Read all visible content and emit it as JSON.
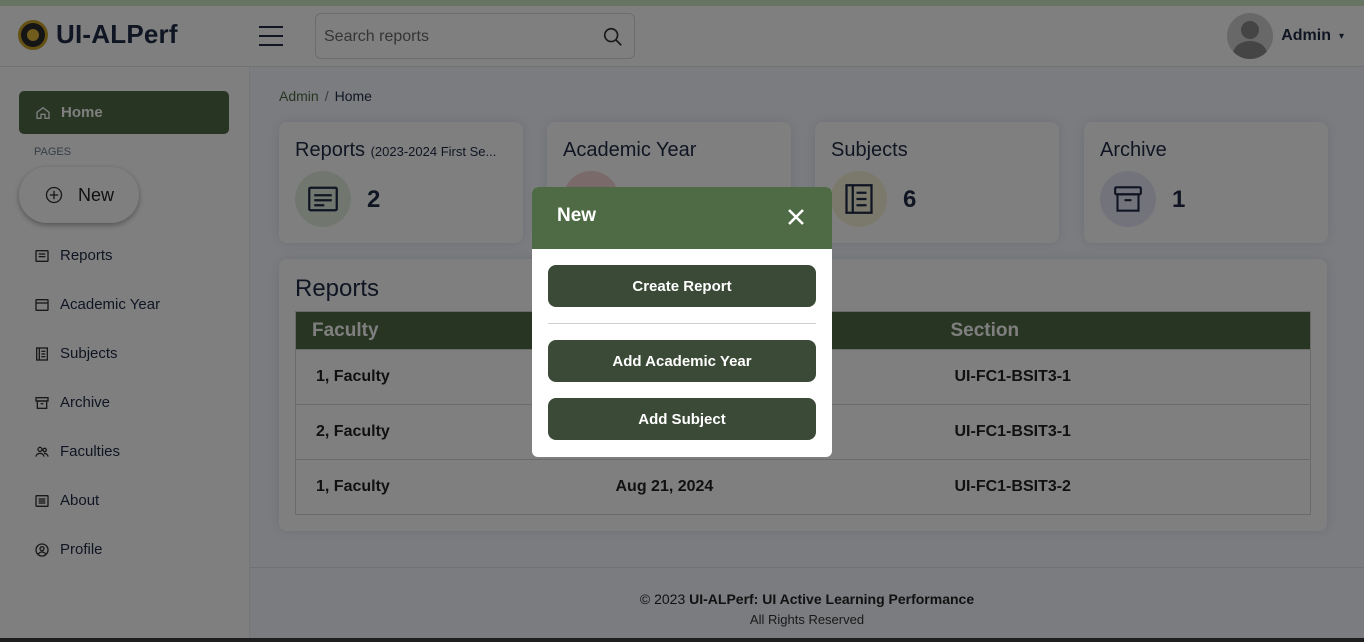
{
  "app": {
    "name": "UI-ALPerf"
  },
  "search": {
    "placeholder": "Search reports"
  },
  "user": {
    "name": "Admin"
  },
  "sidebar": {
    "home_label": "Home",
    "pages_heading": "PAGES",
    "new_label": "New",
    "items": [
      {
        "label": "Reports",
        "icon": "reports-icon"
      },
      {
        "label": "Academic Year",
        "icon": "calendar-icon"
      },
      {
        "label": "Subjects",
        "icon": "book-icon"
      },
      {
        "label": "Archive",
        "icon": "archive-icon"
      },
      {
        "label": "Faculties",
        "icon": "people-icon"
      },
      {
        "label": "About",
        "icon": "info-icon"
      },
      {
        "label": "Profile",
        "icon": "user-circle-icon"
      }
    ]
  },
  "breadcrumb": {
    "parent": "Admin",
    "separator": "/",
    "current": "Home"
  },
  "cards": [
    {
      "title": "Reports",
      "subtitle": "(2023-2024 First Se...",
      "count": "2",
      "icon": "reports-icon",
      "icon_bg": "#e3efdf"
    },
    {
      "title": "Academic Year",
      "subtitle": "",
      "count": "",
      "icon": "calendar-icon",
      "icon_bg": "#f6d5d5"
    },
    {
      "title": "Subjects",
      "subtitle": "",
      "count": "6",
      "icon": "book-icon",
      "icon_bg": "#f7f2d6"
    },
    {
      "title": "Archive",
      "subtitle": "",
      "count": "1",
      "icon": "archive-icon",
      "icon_bg": "#e6e6f8"
    }
  ],
  "reports_table": {
    "title": "Reports",
    "columns": [
      "Faculty",
      "",
      "Section"
    ],
    "rows": [
      [
        "1, Faculty",
        "",
        "UI-FC1-BSIT3-1"
      ],
      [
        "2, Faculty",
        "",
        "UI-FC1-BSIT3-1"
      ],
      [
        "1, Faculty",
        "Aug 21, 2024",
        "UI-FC1-BSIT3-2"
      ]
    ]
  },
  "footer": {
    "copyright_prefix": "© 2023",
    "copyright_bold": "UI-ALPerf: UI Active Learning Performance",
    "rights": "All Rights Reserved"
  },
  "modal": {
    "title": "New",
    "buttons": [
      "Create Report",
      "Add Academic Year",
      "Add Subject"
    ]
  },
  "colors": {
    "accent": "#4e6b45",
    "button_dark": "#3a4a36",
    "topstrip": "#cfe8c4"
  }
}
